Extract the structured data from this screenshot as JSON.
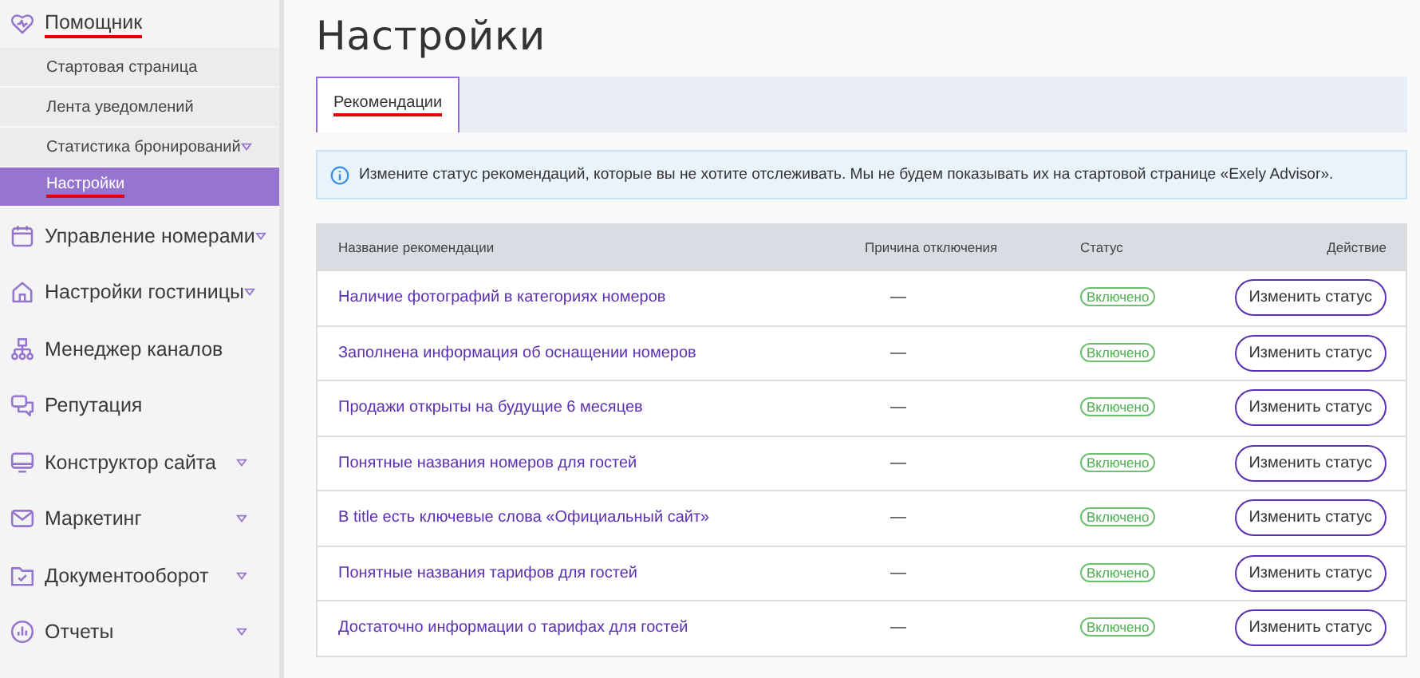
{
  "sidebar": {
    "items": [
      {
        "label": "Помощник",
        "underlined": true,
        "has_caret": false,
        "children": [
          {
            "label": "Стартовая страница",
            "selected": false,
            "underlined": false,
            "has_caret": false
          },
          {
            "label": "Лента уведомлений",
            "selected": false,
            "underlined": false,
            "has_caret": false
          },
          {
            "label": "Статистика бронирований",
            "selected": false,
            "underlined": false,
            "has_caret": true
          },
          {
            "label": "Настройки",
            "selected": true,
            "underlined": true,
            "has_caret": false
          }
        ]
      },
      {
        "label": "Управление номерами",
        "underlined": false,
        "has_caret": true
      },
      {
        "label": "Настройки гостиницы",
        "underlined": false,
        "has_caret": true
      },
      {
        "label": "Менеджер каналов",
        "underlined": false,
        "has_caret": false
      },
      {
        "label": "Репутация",
        "underlined": false,
        "has_caret": false
      },
      {
        "label": "Конструктор сайта",
        "underlined": false,
        "has_caret": true
      },
      {
        "label": "Маркетинг",
        "underlined": false,
        "has_caret": true
      },
      {
        "label": "Документооборот",
        "underlined": false,
        "has_caret": true
      },
      {
        "label": "Отчеты",
        "underlined": false,
        "has_caret": true
      }
    ]
  },
  "page_title": "Настройки",
  "tabs": [
    {
      "label": "Рекомендации",
      "selected": true,
      "underlined": true
    }
  ],
  "info": "Измените статус рекомендаций, которые вы не хотите отслеживать. Мы не будем показывать их на стартовой странице «Exely Advisor».",
  "table": {
    "columns": [
      "Название рекомендации",
      "Причина отключения",
      "Статус",
      "Действие"
    ],
    "rows": [
      {
        "name": "Наличие фотографий в категориях номеров",
        "reason": "—",
        "status": "Включено",
        "enabled": true,
        "action": "Изменить статус"
      },
      {
        "name": "Заполнена информация об оснащении номеров",
        "reason": "—",
        "status": "Включено",
        "enabled": true,
        "action": "Изменить статус"
      },
      {
        "name": "Продажи открыты на будущие 6 месяцев",
        "reason": "—",
        "status": "Включено",
        "enabled": true,
        "action": "Изменить статус"
      },
      {
        "name": "Понятные названия номеров для гостей",
        "reason": "—",
        "status": "Включено",
        "enabled": true,
        "action": "Изменить статус"
      },
      {
        "name": "В title есть ключевые слова «Официальный сайт»",
        "reason": "—",
        "status": "Включено",
        "enabled": true,
        "action": "Изменить статус"
      },
      {
        "name": "Понятные названия тарифов для гостей",
        "reason": "—",
        "status": "Включено",
        "enabled": true,
        "action": "Изменить статус"
      },
      {
        "name": "Достаточно информации о тарифах для гостей",
        "reason": "—",
        "status": "Включено",
        "enabled": true,
        "action": "Изменить статус"
      }
    ]
  }
}
